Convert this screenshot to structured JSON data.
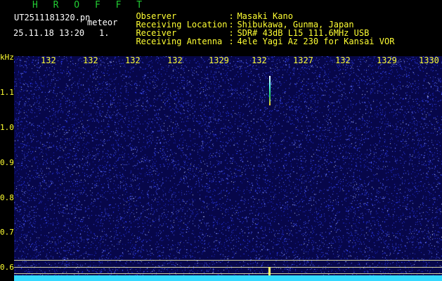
{
  "header": {
    "title": "H R O F F T",
    "filename": "UT2511181320.pn",
    "event_type": "meteor",
    "datetime": "25.11.18 13:20",
    "count": "1."
  },
  "station": [
    {
      "label": "Observer",
      "value": "Masaki Kano"
    },
    {
      "label": "Receiving Location",
      "value": "Shibukawa, Gunma, Japan"
    },
    {
      "label": "Receiver",
      "value": "SDR# 43dB L15 111.6MHz USB"
    },
    {
      "label": "Receiving Antenna",
      "value": "4ele Yagi Az 230 for Kansai VOR"
    }
  ],
  "spectrogram": {
    "unit_label": "kHz",
    "x_ticks": [
      "132",
      "132",
      "132",
      "132",
      "1329",
      "132",
      "1327",
      "132",
      "1329",
      "1330"
    ],
    "y_ticks": [
      "1.1",
      "1.0",
      "0.9",
      "0.8",
      "0.7",
      "0.6"
    ],
    "colors": {
      "background": "#07074a",
      "noise": "#2a3aff",
      "text": "#ffff33",
      "title": "#22cc33",
      "floor": "#33d9ff"
    }
  }
}
